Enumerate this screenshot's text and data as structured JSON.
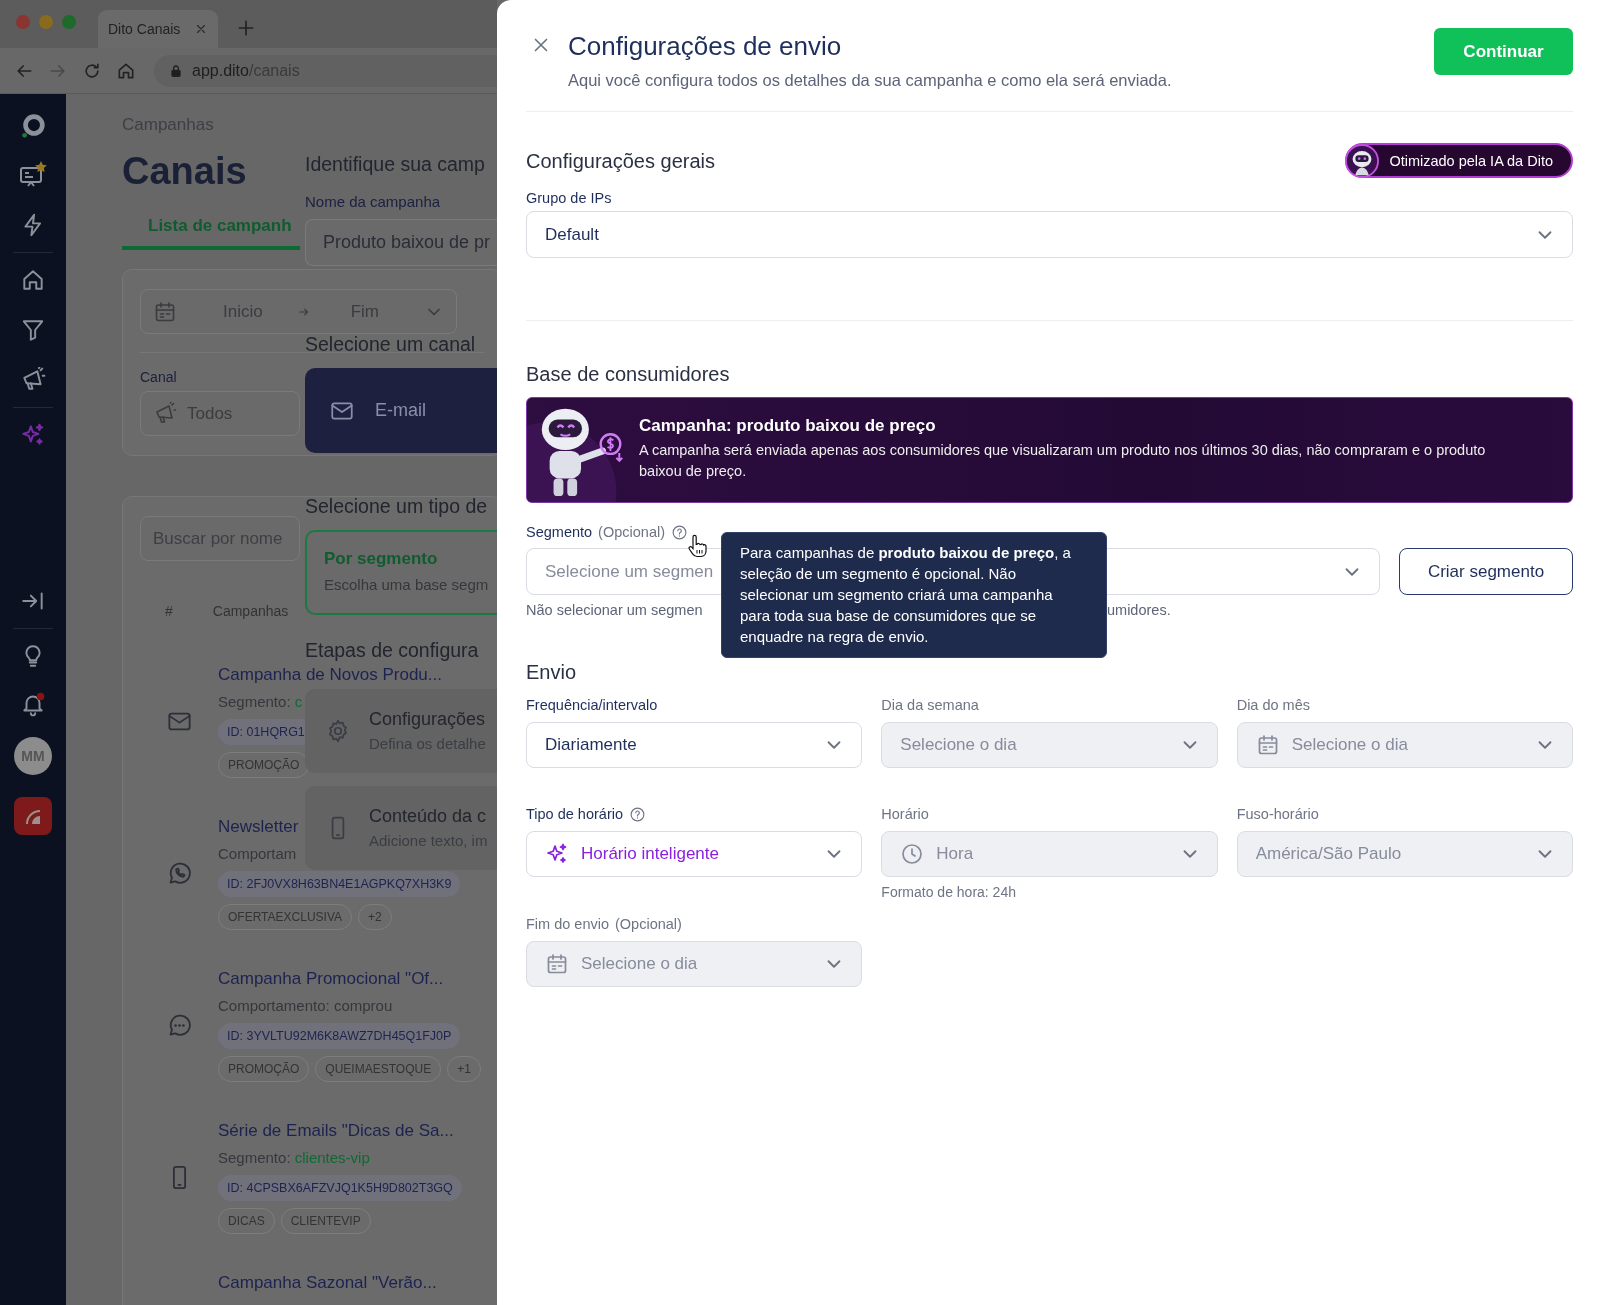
{
  "browser": {
    "tab_title": "Dito Canais",
    "url_host": "app.dito",
    "url_path": "/canais"
  },
  "sidebar": {
    "avatar": "MM",
    "notification": true
  },
  "page": {
    "breadcrumb": "Campanhas",
    "title": "Canais",
    "tabs": [
      {
        "label": "Lista de campanh",
        "selected": true
      }
    ],
    "filters": {
      "date_start": "Inicio",
      "date_end": "Fim",
      "channel_label": "Canal",
      "channel_value": "Todos"
    },
    "search_placeholder": "Buscar por nome",
    "columns": [
      "#",
      "Campanhas"
    ],
    "campaigns": [
      {
        "kind": "email",
        "title": "Campanha de Novos Produ...",
        "detail": "Segmento: ",
        "segment": "c",
        "id": "ID: 01HQRG1",
        "tags": [
          "PROMOÇÃO"
        ]
      },
      {
        "kind": "whatsapp",
        "title": "Newsletter",
        "detail": "Comportam",
        "id": "ID: 2FJ0VX8H63BN4E1AGPKQ7XH3K9",
        "tags": [
          "OFERTAEXCLUSIVA",
          "+2"
        ]
      },
      {
        "kind": "chat",
        "title": "Campanha Promocional \"Of...",
        "detail": "Comportamento: comprou",
        "id": "ID: 3YVLTU92M6K8AWZ7DH45Q1FJ0P",
        "tags": [
          "PROMOÇÃO",
          "QUEIMAESTOQUE",
          "+1"
        ]
      },
      {
        "kind": "sms",
        "title": "Série de Emails \"Dicas de Sa...",
        "detail": "Segmento: ",
        "segment": "clientes-vip",
        "id": "ID: 4CPSBX6AFZVJQ1K5H9D802T3GQ",
        "tags": [
          "DICAS",
          "CLIENTEVIP"
        ]
      },
      {
        "title": "Campanha Sazonal \"Verão..."
      }
    ]
  },
  "wizard": {
    "heading": "Identifique sua camp",
    "name_label": "Nome da campanha",
    "name_value": "Produto baixou de pr",
    "channel_heading": "Selecione um canal",
    "channels": [
      {
        "kind": "email",
        "label": "E-mail",
        "selected": true
      }
    ],
    "type_heading": "Selecione um tipo de",
    "types": [
      {
        "title": "Por segmento",
        "description": "Escolha uma base segm",
        "selected": true
      }
    ],
    "steps_heading": "Etapas de configura",
    "steps": [
      {
        "kind": "settings",
        "title": "Configurações",
        "description": "Defina os detalhe"
      },
      {
        "kind": "content",
        "title": "Conteúdo da c",
        "description": "Adicione texto, im"
      }
    ]
  },
  "drawer": {
    "title": "Configurações de envio",
    "subtitle": "Aqui você configura todos os detalhes da sua campanha e como ela será enviada.",
    "primary_button": "Continuar",
    "general": {
      "heading": "Configurações gerais",
      "badge": "Otimizado pela IA da Dito",
      "ip_group": {
        "label": "Grupo de IPs",
        "value": "Default"
      }
    },
    "audience": {
      "heading": "Base de consumidores",
      "banner": {
        "title": "Campanha: produto baixou de preço",
        "text": "A campanha será enviada apenas aos consumidores que visualizaram um produto nos últimos 30 dias, não compraram e o produto baixou de preço."
      },
      "segment": {
        "label": "Segmento",
        "optional": "(Opcional)",
        "placeholder": "Selecione um segmen",
        "button": "Criar segmento",
        "hint_start": "Não selecionar um segmen",
        "hint_end": "umidores.",
        "tooltip": "Para campanhas de **produto baixou de preço**, a seleção de um segmento é opcional. Não selecionar um segmento criará uma campanha para toda sua base de consumidores que se enquadre na regra de envio."
      }
    },
    "sending": {
      "heading": "Envio",
      "fields": [
        {
          "kind": "select",
          "label": "Frequência/intervalo",
          "help": false,
          "value": "Diariamente",
          "disabled": false
        },
        {
          "kind": "select",
          "label": "Dia da semana",
          "help": false,
          "placeholder": "Selecione o dia",
          "disabled": true
        },
        {
          "kind": "date",
          "label": "Dia do mês",
          "help": false,
          "placeholder": "Selecione o dia",
          "disabled": true
        },
        {
          "kind": "smart",
          "label": "Tipo de horário",
          "help": true,
          "value": "Horário inteligente",
          "disabled": false
        },
        {
          "kind": "time",
          "label": "Horário",
          "help": false,
          "placeholder": "Hora",
          "hint": "Formato de hora: 24h",
          "disabled": true
        },
        {
          "kind": "select",
          "label": "Fuso-horário",
          "help": false,
          "value": "América/São Paulo",
          "disabled": true
        },
        {
          "kind": "date",
          "label": "Fim do envio",
          "optional": "(Opcional)",
          "help": false,
          "placeholder": "Selecione o dia",
          "disabled": true
        }
      ]
    }
  }
}
